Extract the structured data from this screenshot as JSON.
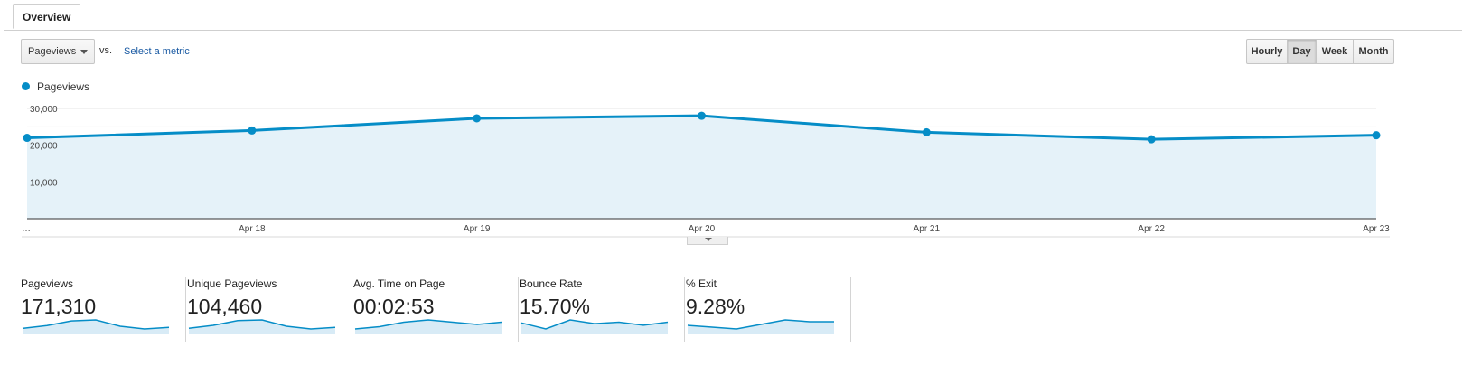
{
  "tabs": {
    "overview": "Overview"
  },
  "controls": {
    "primary_metric": "Pageviews",
    "vs_label": "vs.",
    "select_metric_link": "Select a metric",
    "granularity": [
      "Hourly",
      "Day",
      "Week",
      "Month"
    ],
    "granularity_selected": "Day"
  },
  "colors": {
    "series": "#058dc7",
    "area_fill": "#e5f2f9",
    "spark_fill": "#d8ebf6"
  },
  "chart_data": {
    "type": "area",
    "series": [
      {
        "name": "Pageviews",
        "values": [
          22000,
          24000,
          27300,
          28000,
          23500,
          21600,
          22700
        ]
      }
    ],
    "x": [
      "…",
      "Apr 18",
      "Apr 19",
      "Apr 20",
      "Apr 21",
      "Apr 22",
      "Apr 23"
    ],
    "y_ticks": [
      "30,000",
      "20,000",
      "10,000"
    ],
    "y_tick_values": [
      30000,
      20000,
      10000
    ],
    "ylim": [
      0,
      30000
    ],
    "grid": true,
    "legend": "top-left"
  },
  "scorecards": [
    {
      "label": "Pageviews",
      "value": "171,310",
      "trend": [
        22000,
        24000,
        27300,
        28000,
        23500,
        21600,
        22700
      ]
    },
    {
      "label": "Unique Pageviews",
      "value": "104,460",
      "trend": [
        13500,
        14800,
        16900,
        17200,
        14400,
        13200,
        13900
      ]
    },
    {
      "label": "Avg. Time on Page",
      "value": "00:02:53",
      "trend": [
        170,
        171,
        173,
        174,
        173,
        172,
        173
      ]
    },
    {
      "label": "Bounce Rate",
      "value": "15.70%",
      "trend": [
        15.9,
        15.1,
        16.3,
        15.8,
        16.0,
        15.6,
        16.0
      ]
    },
    {
      "label": "% Exit",
      "value": "9.28%",
      "trend": [
        9.2,
        9.0,
        8.8,
        9.3,
        9.8,
        9.6,
        9.6
      ]
    }
  ]
}
